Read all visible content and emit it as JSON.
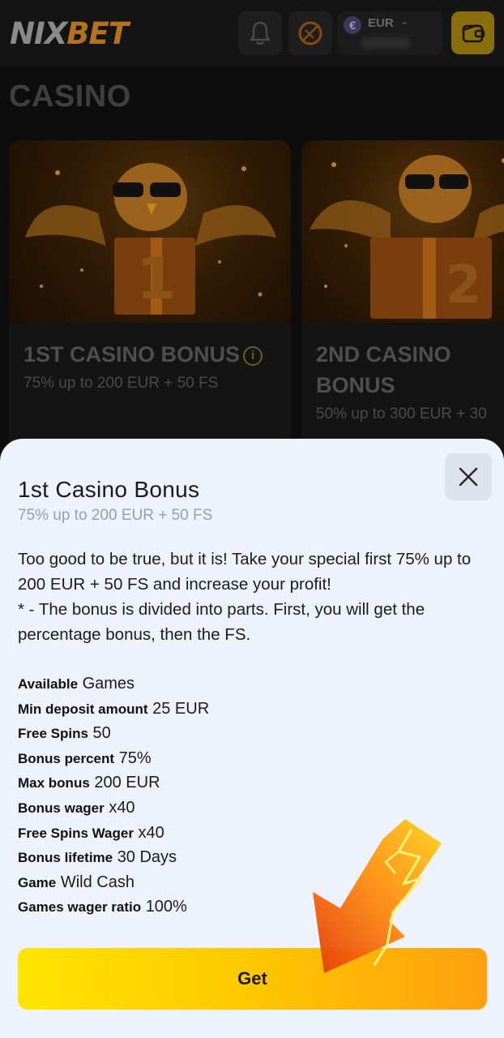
{
  "header": {
    "logo_part1": "NIX",
    "logo_part2": "BET",
    "currency": "EUR"
  },
  "page": {
    "title": "CASINO"
  },
  "cards": [
    {
      "title": "1ST CASINO BONUS",
      "subtitle": "75% up to 200 EUR + 50 FS"
    },
    {
      "title": "2ND CASINO BONUS",
      "subtitle": "50% up to 300 EUR + 30"
    }
  ],
  "modal": {
    "title": "1st Casino Bonus",
    "subtitle": "75% up to 200 EUR + 50 FS",
    "description_1": "Too good to be true, but it is! Take your special first 75% up to 200 EUR + 50 FS and increase your profit!",
    "description_2": "* - The bonus is divided into parts. First, you will get the percentage bonus, then the FS.",
    "details": [
      {
        "label": "Available",
        "value": "Games"
      },
      {
        "label": "Min deposit amount",
        "value": "25 EUR"
      },
      {
        "label": "Free Spins",
        "value": "50"
      },
      {
        "label": "Bonus percent",
        "value": "75%"
      },
      {
        "label": "Max bonus",
        "value": "200 EUR"
      },
      {
        "label": "Bonus wager",
        "value": "x40"
      },
      {
        "label": "Free Spins Wager",
        "value": "x40"
      },
      {
        "label": "Bonus lifetime",
        "value": "30 Days"
      },
      {
        "label": "Game",
        "value": "Wild Cash"
      },
      {
        "label": "Games wager ratio",
        "value": "100%"
      }
    ],
    "get_label": "Get"
  },
  "icons": {
    "bell": "bell-icon",
    "promo": "orange-slice-icon",
    "currency": "euro-icon",
    "wallet": "wallet-icon",
    "close": "close-icon",
    "info": "info-icon",
    "arrow": "lightning-arrow-icon"
  },
  "colors": {
    "accent": "#ffc700",
    "modal_bg": "#eef2fb",
    "page_bg": "#0d0d0d"
  }
}
